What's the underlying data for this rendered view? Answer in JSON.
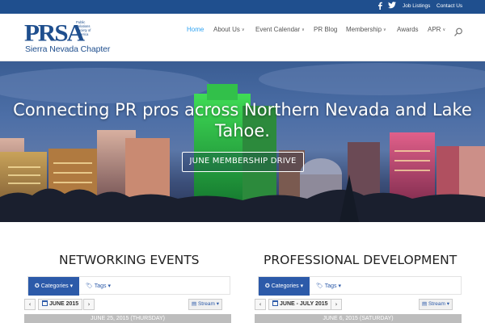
{
  "topbar": {
    "social": [
      "facebook-icon",
      "twitter-icon"
    ],
    "links": [
      "Job Listings",
      "Contact Us"
    ],
    "bg_color": "#1f4f8e"
  },
  "logo": {
    "acronym": "PRSA",
    "org_lines": [
      "Public",
      "Relations",
      "Society of",
      "America"
    ],
    "chapter": "Sierra Nevada Chapter",
    "color": "#1f4f8e"
  },
  "nav": {
    "items": [
      {
        "label": "Home",
        "dropdown": false,
        "active": true
      },
      {
        "label": "About Us",
        "dropdown": true,
        "active": false
      },
      {
        "label": "Event Calendar",
        "dropdown": true,
        "active": false
      },
      {
        "label": "PR Blog",
        "dropdown": false,
        "active": false
      },
      {
        "label": "Membership",
        "dropdown": true,
        "active": false
      },
      {
        "label": "Awards",
        "dropdown": false,
        "active": false
      },
      {
        "label": "APR",
        "dropdown": true,
        "active": false
      }
    ],
    "caret": "∨",
    "active_color": "#2ea3f2",
    "search_icon": "search-icon"
  },
  "hero": {
    "title": "Connecting PR pros across Northern Nevada and Lake Tahoe.",
    "button": "JUNE MEMBERSHIP DRIVE"
  },
  "sections": [
    {
      "title": "NETWORKING EVENTS",
      "categories_label": "Categories",
      "tags_label": "Tags",
      "month_label": "JUNE 2015",
      "stream_label": "Stream",
      "day_label": "JUNE 25, 2015 (THURSDAY)"
    },
    {
      "title": "PROFESSIONAL DEVELOPMENT",
      "categories_label": "Categories",
      "tags_label": "Tags",
      "month_label": "JUNE - JULY 2015",
      "stream_label": "Stream",
      "day_label": "JUNE 6, 2015 (SATURDAY)"
    }
  ],
  "icons": {
    "prev": "‹",
    "next": "›",
    "caret_down": "▾"
  },
  "colors": {
    "accent": "#2c5aa9",
    "day_bar": "#bdbdbd"
  }
}
